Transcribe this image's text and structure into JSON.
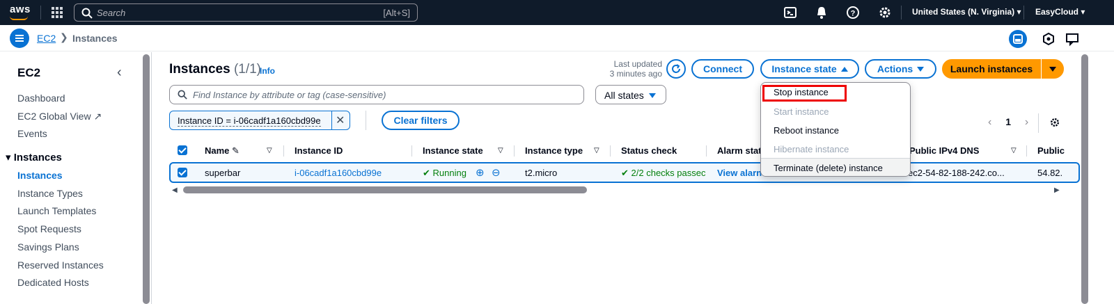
{
  "topnav": {
    "logo": "aws",
    "search_placeholder": "Search",
    "search_shortcut": "[Alt+S]",
    "region": "United States (N. Virginia) ▾",
    "account": "EasyCloud ▾"
  },
  "breadcrumb": {
    "service": "EC2",
    "page": "Instances"
  },
  "sidebar": {
    "title": "EC2",
    "items_top": [
      "Dashboard",
      "EC2 Global View",
      "Events"
    ],
    "section": "Instances",
    "items": [
      "Instances",
      "Instance Types",
      "Launch Templates",
      "Spot Requests",
      "Savings Plans",
      "Reserved Instances",
      "Dedicated Hosts"
    ]
  },
  "header": {
    "title": "Instances",
    "count": "(1/1)",
    "info": "Info",
    "last_updated_1": "Last updated",
    "last_updated_2": "3 minutes ago",
    "connect": "Connect",
    "instance_state": "Instance state",
    "actions": "Actions",
    "launch": "Launch instances"
  },
  "filters": {
    "find_placeholder": "Find Instance by attribute or tag (case-sensitive)",
    "states": "All states",
    "token": "Instance ID = i-06cadf1a160cbd99e",
    "clear": "Clear filters"
  },
  "pager": {
    "page": "1"
  },
  "table": {
    "headers": [
      "Name",
      "Instance ID",
      "Instance state",
      "Instance type",
      "Status check",
      "Alarm stat",
      "Public IPv4 DNS",
      "Public"
    ],
    "row": {
      "name": "superbar",
      "instance_id": "i-06cadf1a160cbd99e",
      "state": "Running",
      "type": "t2.micro",
      "status": "2/2 checks passec",
      "alarm": "View alarn",
      "dns": "ec2-54-82-188-242.co...",
      "ip": "54.82."
    }
  },
  "menu": {
    "items": [
      "Stop instance",
      "Start instance",
      "Reboot instance",
      "Hibernate instance",
      "Terminate (delete) instance"
    ]
  },
  "colors": {
    "accent": "#0972d3",
    "primary": "#ff9900",
    "nav": "#0f1b2a",
    "success": "#037f0c"
  }
}
